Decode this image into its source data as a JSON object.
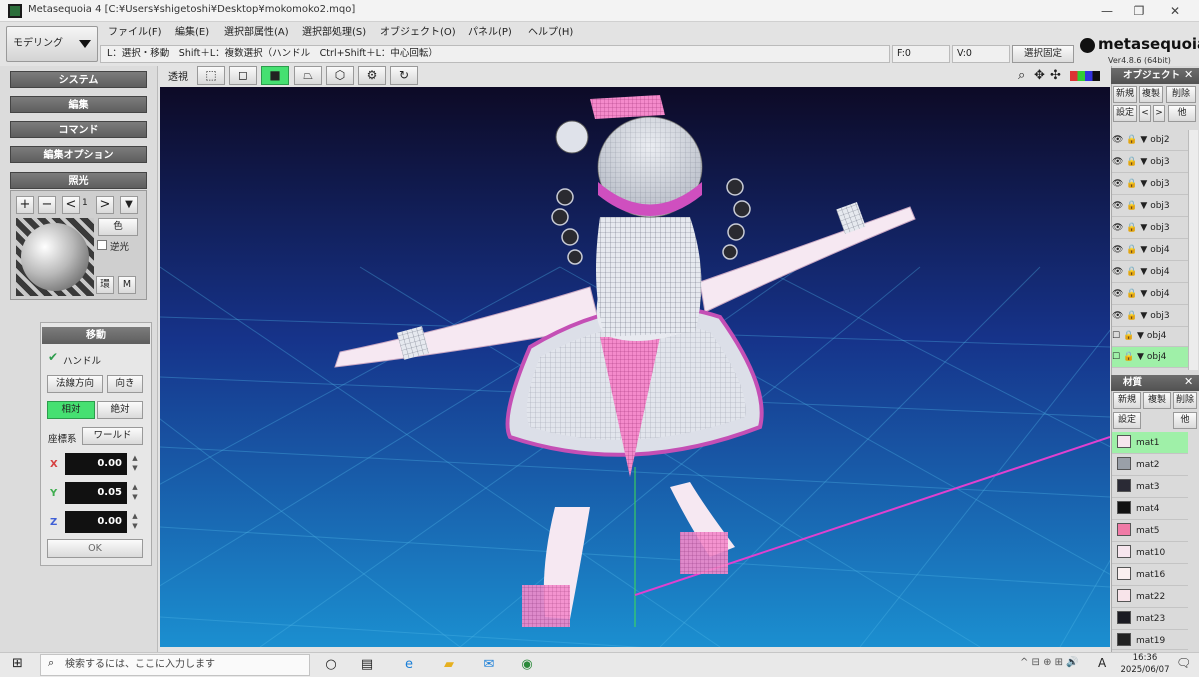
{
  "window": {
    "title": "Metasequoia 4 [C:¥Users¥shigetoshi¥Desktop¥mokomoko2.mqo]",
    "minimize": "—",
    "restore": "❐",
    "close": "✕"
  },
  "mode": {
    "label": "モデリング"
  },
  "menu": [
    "ファイル(F)",
    "編集(E)",
    "選択部属性(A)",
    "選択部処理(S)",
    "オブジェクト(O)",
    "パネル(P)",
    "ヘルプ(H)"
  ],
  "hint": "L：選択・移動　Shift＋L：複数選択（ハンドル　Ctrl+Shift＋L：中心回転）",
  "status": {
    "faces": "F:0",
    "vertices": "V:0",
    "select_fix": "選択固定"
  },
  "logo": {
    "text": "metasequoia4",
    "version": "Ver4.8.6 (64bit)"
  },
  "toolbar": {
    "view": "透視"
  },
  "left": {
    "system": "システム",
    "edit": "編集",
    "command": "コマンド",
    "edit_option": "編集オプション",
    "lighting": {
      "title": "照光",
      "plus": "+",
      "minus": "−",
      "prev": "<",
      "index": "1",
      "next": ">",
      "color": "色",
      "backlight": "逆光",
      "env": "環",
      "m": "M"
    }
  },
  "move": {
    "title": "移動",
    "handle": "ハンドル",
    "normal_dir": "法線方向",
    "direction": "向き",
    "relative": "相対",
    "absolute": "絶対",
    "coord_label": "座標系",
    "coord_value": "ワールド",
    "x_label": "X",
    "x": "0.00",
    "y_label": "Y",
    "y": "0.05",
    "z_label": "Z",
    "z": "0.00",
    "ok": "OK"
  },
  "objects": {
    "title": "オブジェクト",
    "new": "新規",
    "copy": "複製",
    "delete": "削除",
    "settings": "設定",
    "prev": "<",
    "next": ">",
    "other": "他",
    "items": [
      "obj2",
      "obj3",
      "obj3",
      "obj3",
      "obj3",
      "obj4",
      "obj4",
      "obj4",
      "obj3",
      "obj4",
      "obj4"
    ]
  },
  "materials": {
    "title": "材質",
    "new": "新規",
    "copy": "複製",
    "delete": "削除",
    "settings": "設定",
    "other": "他",
    "items": [
      {
        "name": "mat1",
        "color": "#f7e6ee"
      },
      {
        "name": "mat2",
        "color": "#9aa0a8"
      },
      {
        "name": "mat3",
        "color": "#2a2a35"
      },
      {
        "name": "mat4",
        "color": "#111111"
      },
      {
        "name": "mat5",
        "color": "#f07aa6"
      },
      {
        "name": "mat10",
        "color": "#f7e6ee"
      },
      {
        "name": "mat16",
        "color": "#faf0f0"
      },
      {
        "name": "mat22",
        "color": "#f8e4ea"
      },
      {
        "name": "mat23",
        "color": "#1a1a22"
      },
      {
        "name": "mat19",
        "color": "#222222"
      }
    ]
  },
  "taskbar": {
    "search_placeholder": "検索するには、ここに入力します",
    "time": "16:36",
    "date": "2025/06/07",
    "ime": "A"
  },
  "colors": {
    "accent_green": "#46e071",
    "viewport_top": "#0d0a26",
    "viewport_bottom": "#1b8fd0",
    "selection_green": "#9ff0a8"
  }
}
